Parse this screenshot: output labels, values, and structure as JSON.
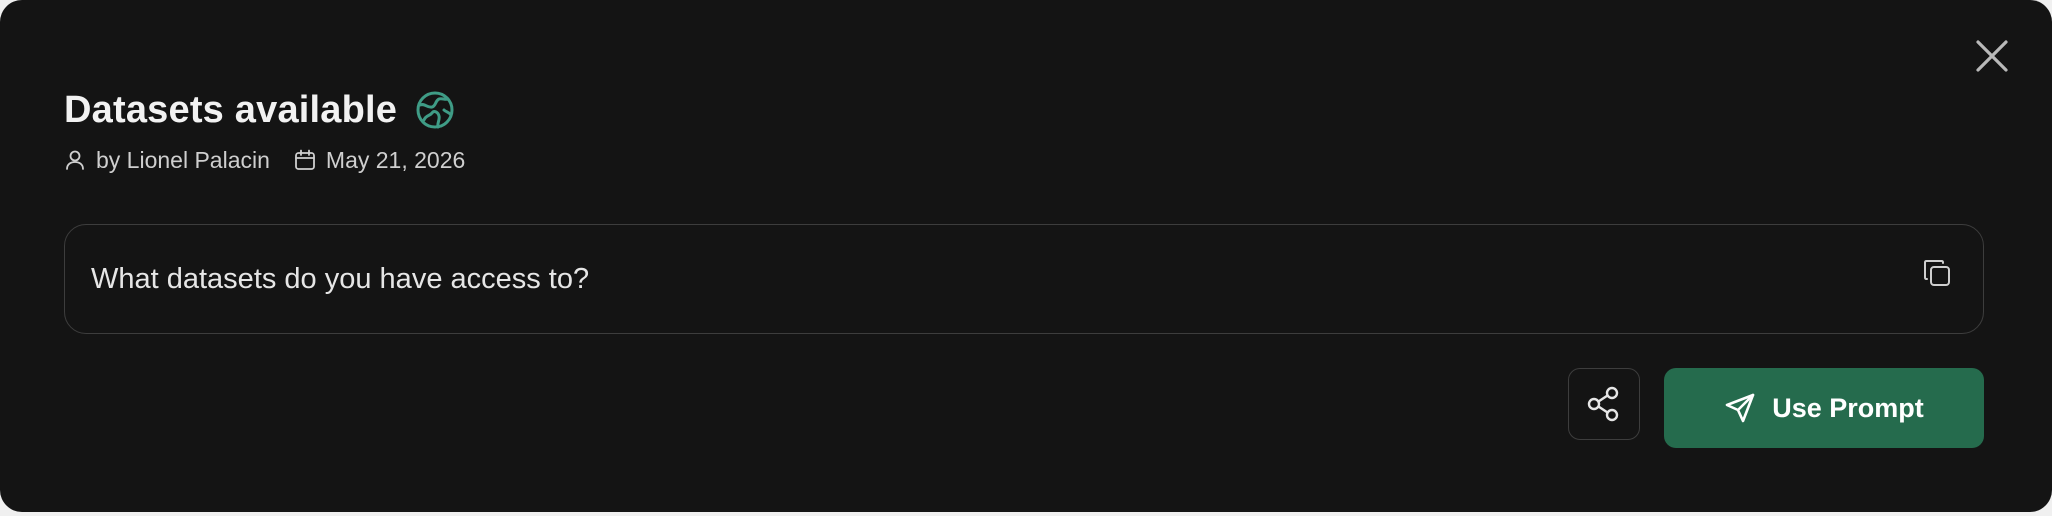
{
  "dialog": {
    "title": "Datasets available",
    "title_icon": "globe-icon",
    "close_icon": "close-icon",
    "meta": {
      "author": "by Lionel Palacin",
      "author_icon": "user-icon",
      "date": "May 21, 2026",
      "date_icon": "calendar-icon"
    },
    "prompt": {
      "text": "What datasets do you have access to?",
      "copy_icon": "copy-icon"
    },
    "actions": {
      "share_icon": "share-icon",
      "use_prompt_label": "Use Prompt",
      "use_prompt_icon": "send-icon"
    }
  },
  "colors": {
    "background": "#141414",
    "text_primary": "#f2f2f2",
    "text_secondary": "#cfcfcf",
    "border": "#3d3d3d",
    "accent": "#256b4d",
    "globe": "#3f9c86"
  }
}
